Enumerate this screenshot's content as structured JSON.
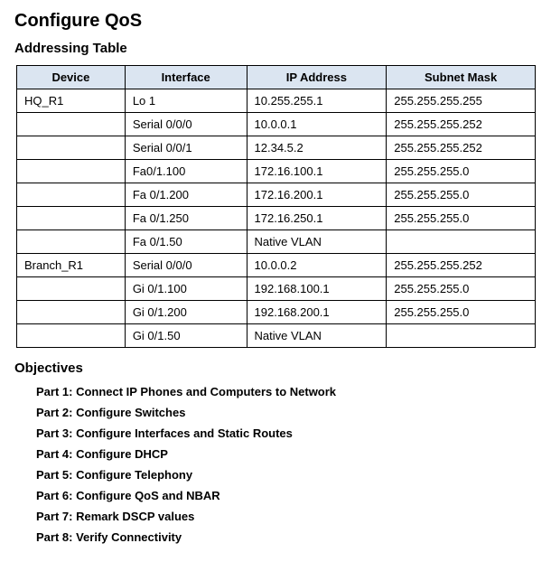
{
  "title": "Configure QoS",
  "addressing_heading": "Addressing Table",
  "table": {
    "headers": {
      "device": "Device",
      "interface": "Interface",
      "ip": "IP Address",
      "mask": "Subnet Mask"
    },
    "rows": [
      {
        "device": "HQ_R1",
        "interface": "Lo 1",
        "ip": "10.255.255.1",
        "mask": "255.255.255.255"
      },
      {
        "device": "",
        "interface": "Serial 0/0/0",
        "ip": "10.0.0.1",
        "mask": "255.255.255.252"
      },
      {
        "device": "",
        "interface": "Serial 0/0/1",
        "ip": "12.34.5.2",
        "mask": "255.255.255.252"
      },
      {
        "device": "",
        "interface": "Fa0/1.100",
        "ip": "172.16.100.1",
        "mask": "255.255.255.0"
      },
      {
        "device": "",
        "interface": "Fa 0/1.200",
        "ip": "172.16.200.1",
        "mask": "255.255.255.0"
      },
      {
        "device": "",
        "interface": "Fa 0/1.250",
        "ip": "172.16.250.1",
        "mask": "255.255.255.0"
      },
      {
        "device": "",
        "interface": "Fa 0/1.50",
        "ip": "Native VLAN",
        "mask": ""
      },
      {
        "device": "Branch_R1",
        "interface": "Serial 0/0/0",
        "ip": "10.0.0.2",
        "mask": "255.255.255.252"
      },
      {
        "device": "",
        "interface": "Gi 0/1.100",
        "ip": "192.168.100.1",
        "mask": "255.255.255.0"
      },
      {
        "device": "",
        "interface": "Gi 0/1.200",
        "ip": "192.168.200.1",
        "mask": "255.255.255.0"
      },
      {
        "device": "",
        "interface": "Gi 0/1.50",
        "ip": "Native VLAN",
        "mask": ""
      }
    ]
  },
  "objectives_heading": "Objectives",
  "objectives": [
    "Part 1: Connect IP Phones and Computers to Network",
    "Part 2: Configure Switches",
    "Part 3: Configure Interfaces and Static Routes",
    "Part 4: Configure DHCP",
    "Part 5: Configure Telephony",
    "Part 6: Configure QoS and NBAR",
    "Part 7: Remark DSCP values",
    "Part 8: Verify Connectivity"
  ]
}
